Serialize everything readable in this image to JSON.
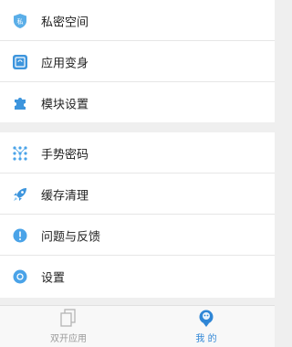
{
  "menu": {
    "group1": [
      {
        "label": "私密空间",
        "icon": "lock-badge-icon"
      },
      {
        "label": "应用变身",
        "icon": "app-transform-icon"
      },
      {
        "label": "模块设置",
        "icon": "puzzle-piece-icon"
      }
    ],
    "group2": [
      {
        "label": "手势密码",
        "icon": "gesture-pattern-icon"
      },
      {
        "label": "缓存清理",
        "icon": "rocket-icon"
      },
      {
        "label": "问题与反馈",
        "icon": "feedback-icon"
      },
      {
        "label": "设置",
        "icon": "settings-icon"
      }
    ],
    "badge_text": "私"
  },
  "tabbar": {
    "tabs": [
      {
        "label": "双开应用",
        "icon": "dual-app-icon",
        "active": false
      },
      {
        "label": "我 的",
        "icon": "profile-icon",
        "active": true
      }
    ]
  },
  "colors": {
    "accent": "#2f86d6",
    "icon_blue": "#4aa3e8",
    "text": "#222222",
    "inactive_tab": "#9a9a9a",
    "background": "#efefef"
  }
}
